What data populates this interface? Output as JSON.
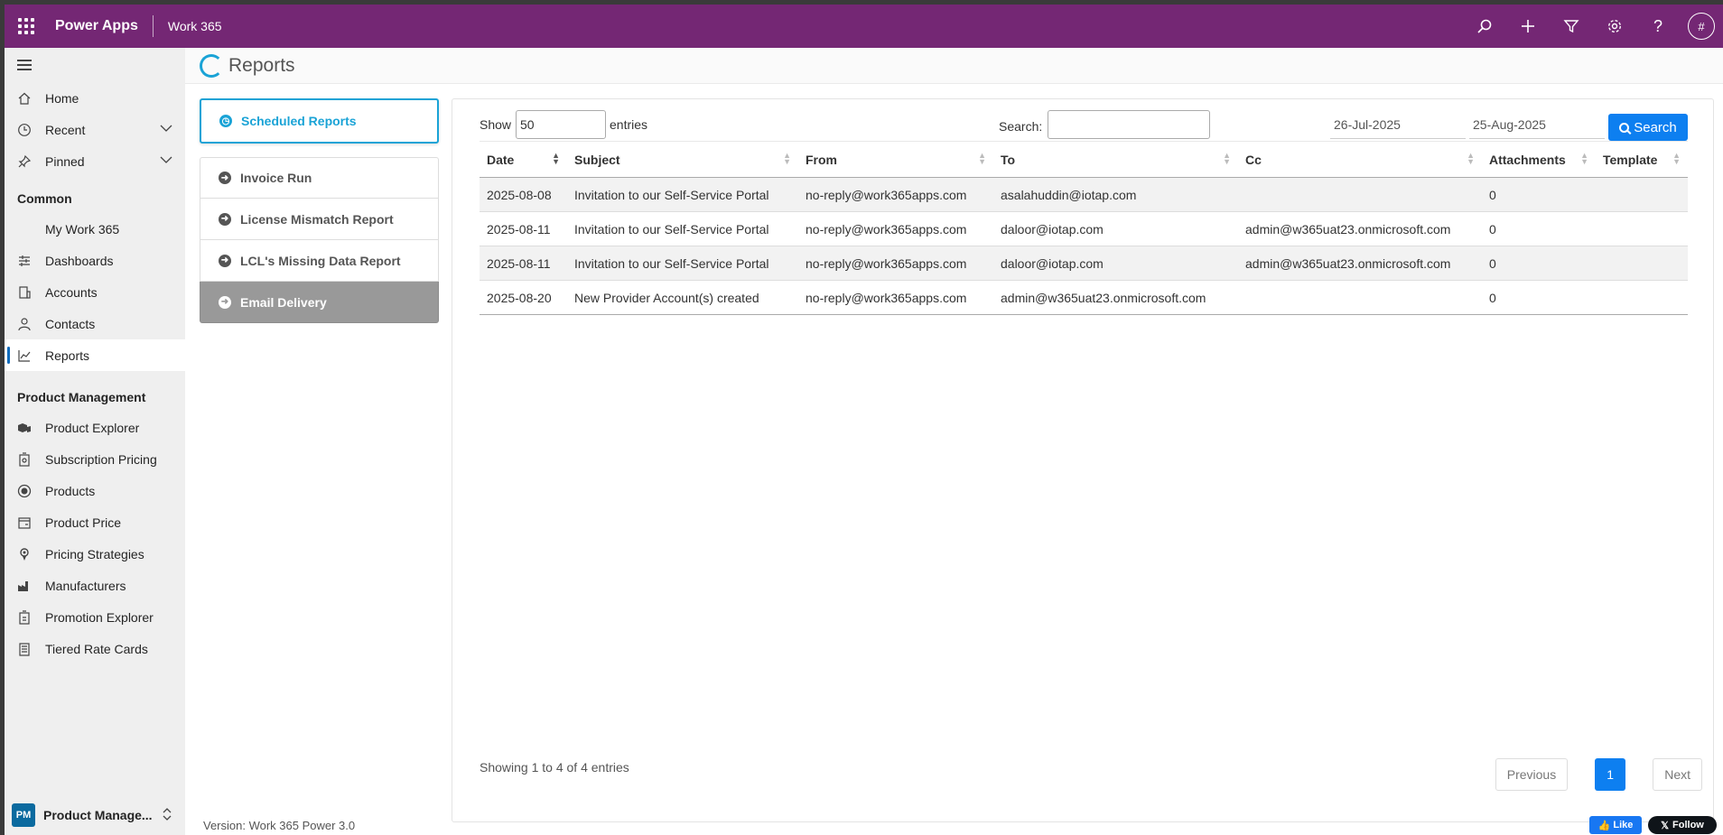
{
  "topbar": {
    "app_name": "Power Apps",
    "environment": "Work 365",
    "avatar_initial": "#"
  },
  "sidebar": {
    "items_top": [
      {
        "label": "Home",
        "icon": "home-icon"
      },
      {
        "label": "Recent",
        "icon": "clock-icon"
      },
      {
        "label": "Pinned",
        "icon": "pin-icon"
      }
    ],
    "common_title": "Common",
    "common_items": [
      {
        "label": "My Work 365"
      },
      {
        "label": "Dashboards",
        "icon": "dashboard-icon"
      },
      {
        "label": "Accounts",
        "icon": "accounts-icon"
      },
      {
        "label": "Contacts",
        "icon": "contact-icon"
      },
      {
        "label": "Reports",
        "icon": "chart-icon"
      }
    ],
    "pm_title": "Product Management",
    "pm_items": [
      {
        "label": "Product Explorer",
        "icon": "cubes-icon"
      },
      {
        "label": "Subscription Pricing",
        "icon": "pricing-icon"
      },
      {
        "label": "Products",
        "icon": "product-icon"
      },
      {
        "label": "Product Price",
        "icon": "price-icon"
      },
      {
        "label": "Pricing Strategies",
        "icon": "strategy-icon"
      },
      {
        "label": "Manufacturers",
        "icon": "factory-icon"
      },
      {
        "label": "Promotion Explorer",
        "icon": "promotion-icon"
      },
      {
        "label": "Tiered Rate Cards",
        "icon": "ratecard-icon"
      }
    ],
    "footer_badge": "PM",
    "footer_label": "Product Manage..."
  },
  "page": {
    "title": "Reports"
  },
  "menu": {
    "scheduled": "Scheduled Reports",
    "invoice_run": "Invoice Run",
    "license_mismatch": "License Mismatch Report",
    "lcl_missing": "LCL's Missing Data Report",
    "email_delivery": "Email Delivery"
  },
  "controls": {
    "show_label": "Show",
    "show_value": "50",
    "entries_label": "entries",
    "search_label": "Search:",
    "search_value": "",
    "date_from": "26-Jul-2025",
    "date_to": "25-Aug-2025",
    "search_button": "Search"
  },
  "table": {
    "headers": [
      "Date",
      "Subject",
      "From",
      "To",
      "Cc",
      "Attachments",
      "Template"
    ],
    "rows": [
      [
        "2025-08-08",
        "Invitation to our Self-Service Portal",
        "no-reply@work365apps.com",
        "asalahuddin@iotap.com",
        "",
        "0",
        ""
      ],
      [
        "2025-08-11",
        "Invitation to our Self-Service Portal",
        "no-reply@work365apps.com",
        "daloor@iotap.com",
        "admin@w365uat23.onmicrosoft.com",
        "0",
        ""
      ],
      [
        "2025-08-11",
        "Invitation to our Self-Service Portal",
        "no-reply@work365apps.com",
        "daloor@iotap.com",
        "admin@w365uat23.onmicrosoft.com",
        "0",
        ""
      ],
      [
        "2025-08-20",
        "New Provider Account(s) created",
        "no-reply@work365apps.com",
        "admin@w365uat23.onmicrosoft.com",
        "",
        "0",
        ""
      ]
    ]
  },
  "footer": {
    "info": "Showing 1 to 4 of 4 entries",
    "previous": "Previous",
    "page": "1",
    "next": "Next",
    "version": "Version: Work 365 Power 3.0",
    "like": "Like",
    "follow": "Follow"
  },
  "colors": {
    "topbar": "#742774",
    "accent": "#1aa3d6",
    "primary_button": "#0d7ff0"
  }
}
